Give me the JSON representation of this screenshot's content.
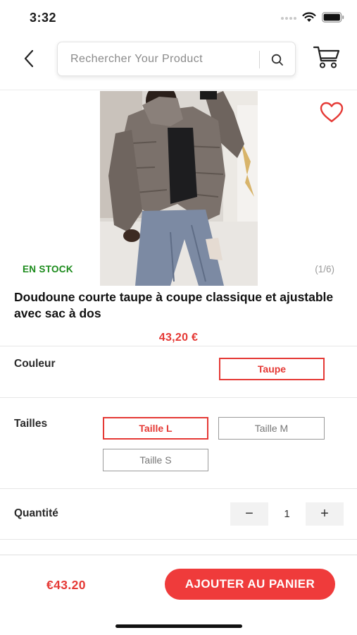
{
  "status_bar": {
    "time": "3:32"
  },
  "header": {
    "search_placeholder": "Rechercher Your Product"
  },
  "product": {
    "stock_status": "EN STOCK",
    "image_counter": "(1/6)",
    "title": "Doudoune courte taupe à coupe classique et ajustable avec sac à dos",
    "price": "43,20 €"
  },
  "options": {
    "color": {
      "label": "Couleur",
      "values": [
        "Taupe"
      ],
      "selected": "Taupe"
    },
    "sizes": {
      "label": "Tailles",
      "values": [
        "Taille L",
        "Taille M",
        "Taille S"
      ],
      "selected": "Taille L"
    },
    "quantity": {
      "label": "Quantité",
      "value": "1",
      "minus": "−",
      "plus": "+"
    }
  },
  "bottom_bar": {
    "price": "€43.20",
    "add_to_cart_label": "AJOUTER AU PANIER"
  },
  "colors": {
    "accent": "#e53935",
    "button": "#ef3b3b",
    "in_stock": "#1a8a1a"
  },
  "icons": [
    "back-arrow-icon",
    "search-icon",
    "cart-icon",
    "heart-icon",
    "wifi-icon",
    "battery-icon",
    "signal-icon"
  ]
}
